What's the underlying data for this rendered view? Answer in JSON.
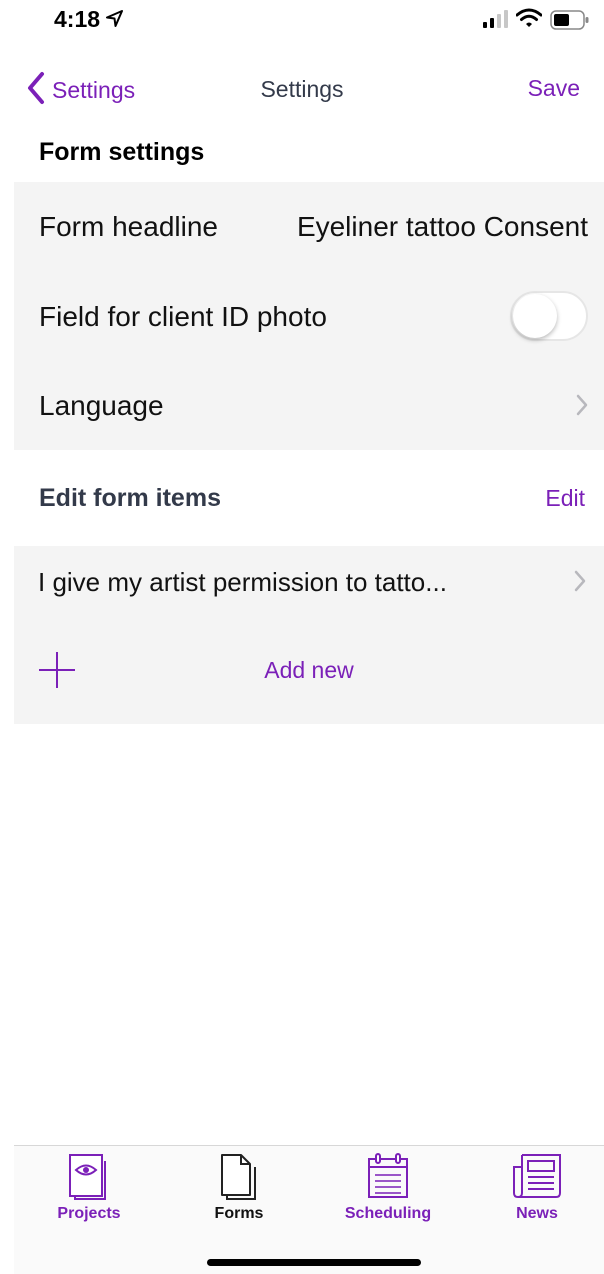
{
  "status_bar": {
    "time": "4:18"
  },
  "nav": {
    "back_label": "Settings",
    "title": "Settings",
    "save_label": "Save"
  },
  "form_settings": {
    "header": "Form settings",
    "rows": [
      {
        "label": "Form headline",
        "value": "Eyeliner tattoo Consent"
      },
      {
        "label": "Field for client ID photo",
        "toggle_on": false
      },
      {
        "label": "Language"
      }
    ]
  },
  "form_items": {
    "header": "Edit  form items",
    "edit_label": "Edit",
    "items": [
      "I give my artist permission to tatto..."
    ],
    "add_label": "Add new"
  },
  "tab_bar": {
    "active": "Forms",
    "tabs": [
      {
        "label": "Projects",
        "icon": "eye-document-icon"
      },
      {
        "label": "Forms",
        "icon": "documents-icon"
      },
      {
        "label": "Scheduling",
        "icon": "calendar-icon"
      },
      {
        "label": "News",
        "icon": "newspaper-icon"
      }
    ]
  },
  "colors": {
    "accent": "#7b20b8",
    "group_bg": "#f4f4f4",
    "dark_text": "#333a4a"
  }
}
